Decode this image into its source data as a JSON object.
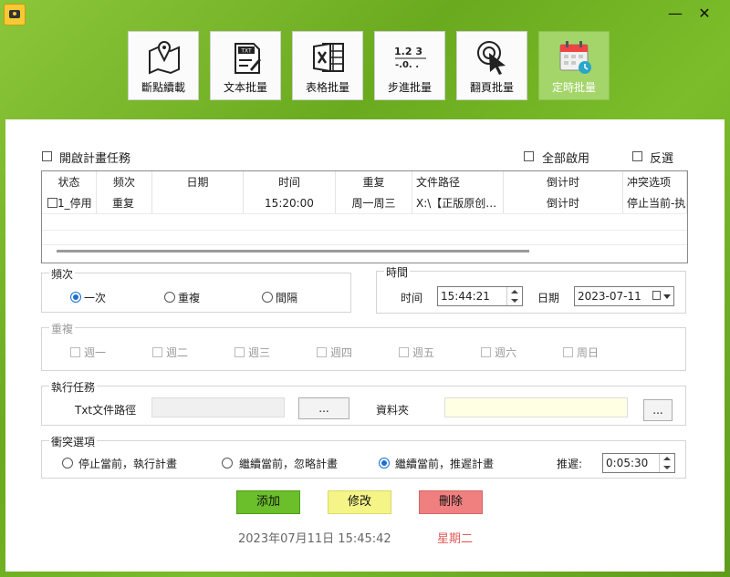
{
  "window": {
    "minimize": "—",
    "close": "✕"
  },
  "toolbar": [
    {
      "label": "斷點續載",
      "icon": "map-pin-icon"
    },
    {
      "label": "文本批量",
      "icon": "txt-file-icon"
    },
    {
      "label": "表格批量",
      "icon": "excel-icon"
    },
    {
      "label": "步進批量",
      "icon": "step-numbers-icon"
    },
    {
      "label": "翻頁批量",
      "icon": "cursor-click-icon"
    },
    {
      "label": "定時批量",
      "icon": "calendar-clock-icon"
    }
  ],
  "schedule": {
    "enable_label": "開啟計畫任務",
    "enable_all_label": "全部啟用",
    "invert_label": "反選"
  },
  "table": {
    "headers": [
      "状态",
      "频次",
      "日期",
      "时间",
      "重复",
      "文件路径",
      "倒计时",
      "冲突选项"
    ],
    "rows": [
      {
        "status": "1_停用",
        "freq": "重复",
        "date": "",
        "time": "15:20:00",
        "repeat": "周一周三",
        "path": "X:\\【正版原创…",
        "countdown": "倒计时",
        "conflict": "停止当前-执"
      }
    ]
  },
  "frequency": {
    "title": "頻次",
    "options": [
      "一次",
      "重複",
      "間隔"
    ],
    "selected": "一次"
  },
  "time_group": {
    "title": "時間",
    "time_label": "时间",
    "time_value": "15:44:21",
    "date_label": "日期",
    "date_value": "2023-07-11"
  },
  "repeat_group": {
    "title": "重複",
    "days": [
      "週一",
      "週二",
      "週三",
      "週四",
      "週五",
      "週六",
      "周日"
    ]
  },
  "task_group": {
    "title": "執行任務",
    "txt_label": "Txt文件路徑",
    "browse1": "...",
    "folder_label": "資料夾",
    "browse2": "..."
  },
  "conflict_group": {
    "title": "衝突選項",
    "options": [
      "停止當前，執行計畫",
      "繼續當前，忽略計畫",
      "繼續當前，推遲計畫"
    ],
    "selected": "繼續當前，推遲計畫",
    "delay_label": "推遲:",
    "delay_value": "0:05:30"
  },
  "actions": {
    "add": "添加",
    "modify": "修改",
    "delete": "刪除"
  },
  "footer": {
    "datetime": "2023年07月11日 15:45:42",
    "weekday": "星期二"
  },
  "colors": {
    "add": "#6bbf2a",
    "modify": "#f4f487",
    "delete": "#f08080",
    "weekday": "#e05a5a",
    "accent": "#1a6fd0"
  }
}
